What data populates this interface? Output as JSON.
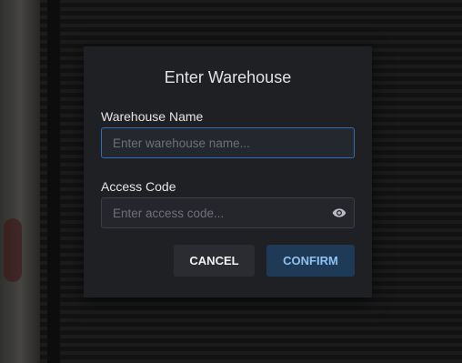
{
  "dialog": {
    "title": "Enter Warehouse",
    "name_label": "Warehouse Name",
    "name_placeholder": "Enter warehouse name...",
    "name_value": "",
    "code_label": "Access Code",
    "code_placeholder": "Enter access code...",
    "code_value": "",
    "reveal_icon": "eye-icon",
    "cancel_label": "CANCEL",
    "confirm_label": "CONFIRM"
  },
  "colors": {
    "dialog_bg": "#1e2024",
    "focus_border": "#2f6fb3",
    "confirm_bg": "#1f3a57",
    "confirm_text": "#8fc1ef"
  }
}
